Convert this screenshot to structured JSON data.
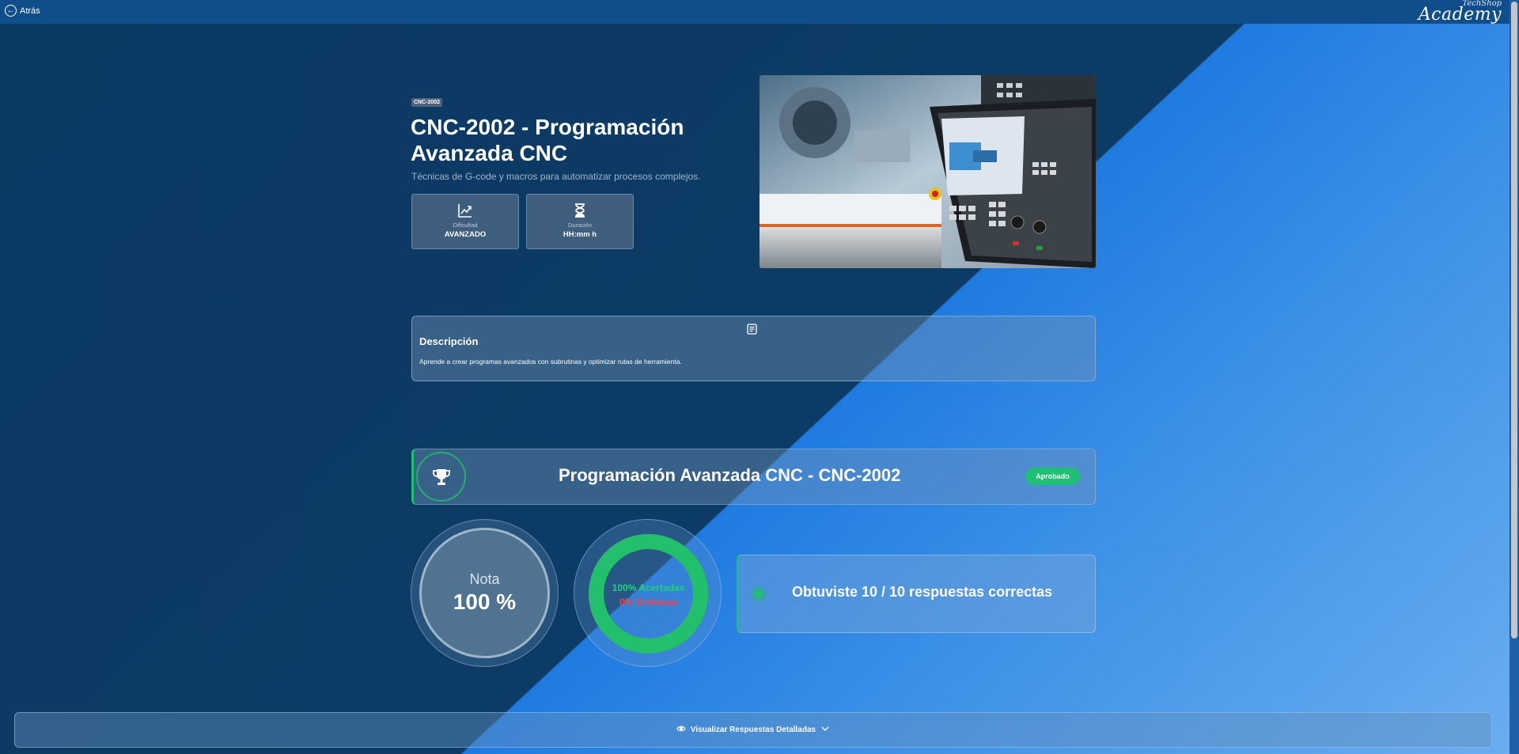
{
  "topbar": {
    "back_label": "Atrás",
    "logo_small": "TechShop",
    "logo_big": "Academy"
  },
  "course": {
    "code": "CNC-2002",
    "title": "CNC-2002 - Programación Avanzada CNC",
    "subtitle": "Técnicas de G-code y macros para automatizar procesos complejos.",
    "difficulty_label": "Dificultad",
    "difficulty_value": "AVANZADO",
    "duration_label": "Duración",
    "duration_value": "HH:mm h"
  },
  "description": {
    "title": "Descripción",
    "text": "Aprende a crear programas avanzados con subrutinas y optimizar rutas de herramienta."
  },
  "result": {
    "banner_title": "Programación Avanzada CNC - CNC-2002",
    "status": "Aprobado",
    "grade_label": "Nota",
    "grade_value": "100 %",
    "correct_label": "100% Acertadas",
    "wrong_label": "0% Erróneas",
    "correct_fraction": 1.0,
    "score_text": "Obtuviste 10 / 10 respuestas correctas"
  },
  "details_button": "Visualizar Respuestas Detalladas",
  "colors": {
    "accent_green": "#20c070",
    "error_red": "#ff4040",
    "topbar": "#0f4e8a"
  }
}
